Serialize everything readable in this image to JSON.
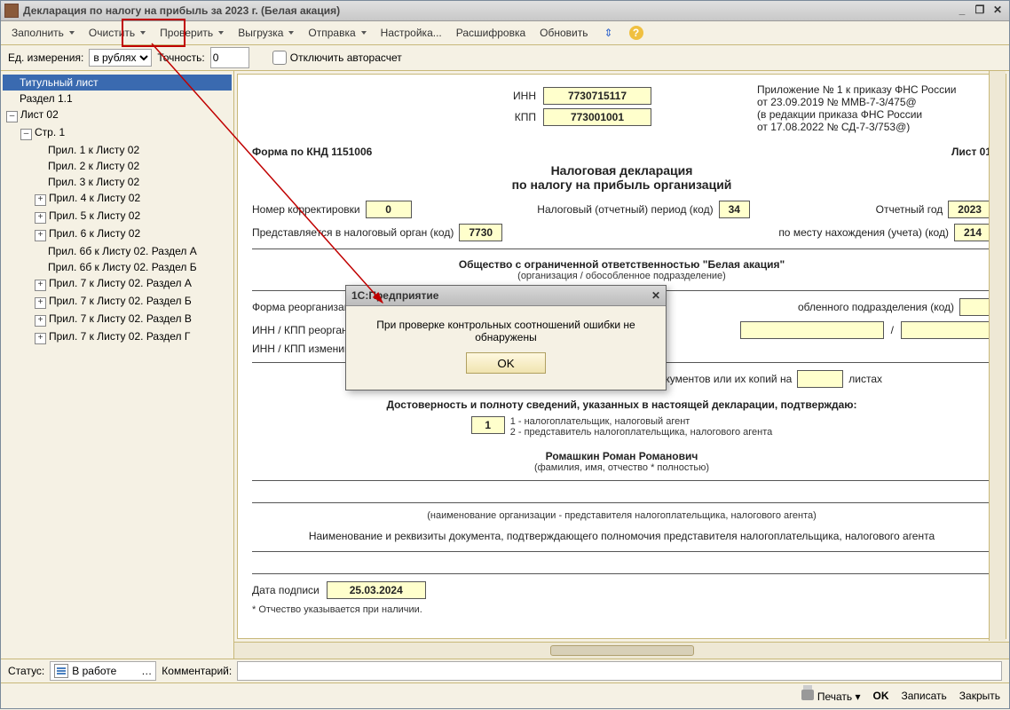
{
  "window": {
    "title": "Декларация по налогу на прибыль за 2023 г. (Белая акация)"
  },
  "toolbar": {
    "fill": "Заполнить",
    "clear": "Очистить",
    "check": "Проверить",
    "export": "Выгрузка",
    "send": "Отправка",
    "settings": "Настройка...",
    "decode": "Расшифровка",
    "refresh": "Обновить"
  },
  "params": {
    "units_label": "Ед. измерения:",
    "units_value": "в рублях",
    "precision_label": "Точность:",
    "precision_value": "0",
    "autorecalc_label": "Отключить авторасчет"
  },
  "tree": {
    "title_page": "Титульный лист",
    "section_1_1": "Раздел 1.1",
    "sheet_02": "Лист 02",
    "page_1": "Стр. 1",
    "items": [
      "Прил. 1 к Листу 02",
      "Прил. 2 к Листу 02",
      "Прил. 3 к Листу 02",
      "Прил. 4 к Листу 02",
      "Прил. 5 к Листу 02",
      "Прил. 6 к Листу 02",
      "Прил. 6б к Листу 02. Раздел А",
      "Прил. 6б к Листу 02. Раздел Б",
      "Прил. 7 к Листу 02. Раздел А",
      "Прил. 7 к Листу 02. Раздел Б",
      "Прил. 7 к Листу 02. Раздел В",
      "Прил. 7 к Листу 02. Раздел Г"
    ]
  },
  "form": {
    "inn_label": "ИНН",
    "inn": "7730715117",
    "kpp_label": "КПП",
    "kpp": "773001001",
    "order_info_1": "Приложение № 1 к приказу ФНС России",
    "order_info_2": "от 23.09.2019 № ММВ-7-3/475@",
    "order_info_3": "(в редакции приказа ФНС России",
    "order_info_4": "от 17.08.2022 № СД-7-3/753@)",
    "form_knd": "Форма по КНД 1151006",
    "sheet_label": "Лист 01",
    "title1": "Налоговая декларация",
    "title2": "по налогу на прибыль организаций",
    "corr_label": "Номер корректировки",
    "corr": "0",
    "period_label": "Налоговый (отчетный) период (код)",
    "period": "34",
    "year_label": "Отчетный год",
    "year": "2023",
    "submit_label": "Представляется в налоговый орган (код)",
    "submit": "7730",
    "place_label": "по месту нахождения (учета) (код)",
    "place": "214",
    "org_name": "Общество с ограниченной ответственностью \"Белая акация\"",
    "org_subtitle": "(организация / обособленное подразделение)",
    "reorg_label": "Форма реорганизаци",
    "liquid_label": "обленного подразделения (код)",
    "inn_kpp_reorg": "ИНН / КПП реорганиз",
    "inn_kpp_change": "ИНН / КПП изменивш",
    "slash": "/",
    "attach_1": "Декларация составлена с приложением подтверждающих документов или их копий на",
    "attach_2": "листах",
    "confirm_title": "Достоверность и полноту сведений, указанных в настоящей декларации, подтверждаю:",
    "confirm_code": "1",
    "confirm_opt1": "1 - налогоплательщик, налоговый агент",
    "confirm_opt2": "2 - представитель налогоплательщика, налогового агента",
    "person": "Ромашкин Роман Романович",
    "person_sub": "(фамилия, имя, отчество *  полностью)",
    "rep_org_sub": "(наименование организации - представителя налогоплательщика, налогового агента)",
    "auth_doc": "Наименование и реквизиты документа, подтверждающего полномочия представителя налогоплательщика, налогового агента",
    "sign_date_label": "Дата подписи",
    "sign_date": "25.03.2024",
    "footnote": "* Отчество указывается при наличии."
  },
  "dialog": {
    "title": "1С:Предприятие",
    "message": "При проверке контрольных соотношений ошибки не обнаружены",
    "ok": "OK"
  },
  "status": {
    "status_label": "Статус:",
    "status_value": "В работе",
    "comment_label": "Комментарий:"
  },
  "footer": {
    "print": "Печать",
    "ok": "OK",
    "save": "Записать",
    "close": "Закрыть"
  }
}
